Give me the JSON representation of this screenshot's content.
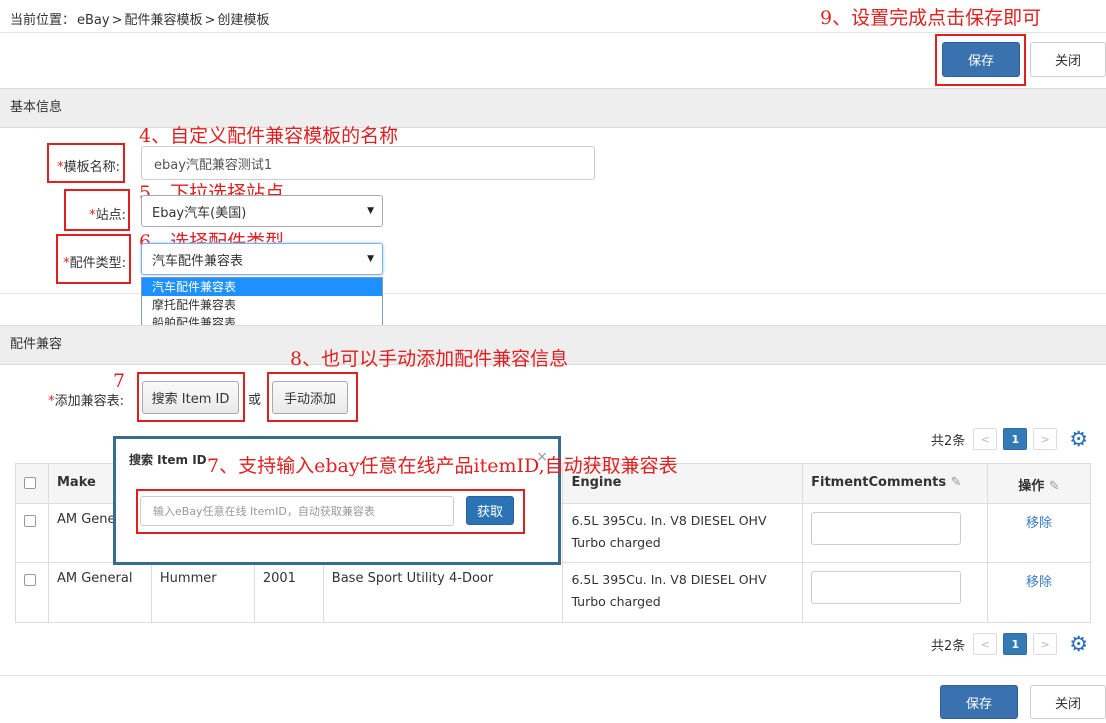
{
  "breadcrumb": {
    "prefix": "当前位置：",
    "item1": "eBay",
    "sep1": ">",
    "item2": "配件兼容模板",
    "sep2": ">",
    "item3": "创建模板"
  },
  "toolbar": {
    "save_label": "保存",
    "close_label": "关闭"
  },
  "basic_section": {
    "title": "基本信息"
  },
  "form": {
    "template_name_label": "模板名称:",
    "template_name_value": "ebay汽配兼容测试1",
    "site_label": "站点:",
    "site_value": "Ebay汽车(美国)",
    "parts_type_label": "配件类型:",
    "parts_type_value": "汽车配件兼容表",
    "parts_type_options": [
      "汽车配件兼容表",
      "摩托配件兼容表",
      "船舶配件兼容表"
    ],
    "required_mark": "*"
  },
  "compat_section": {
    "title": "配件兼容",
    "add_label": "添加兼容表:",
    "search_button": "搜索 Item ID",
    "or_text": "或",
    "manual_button": "手动添加"
  },
  "pager": {
    "total": "共2条",
    "prev": "<",
    "page": "1",
    "next": ">"
  },
  "table": {
    "headers": [
      "Make",
      "",
      "",
      "",
      "Engine",
      "FitmentComments",
      "操作"
    ],
    "rows": [
      {
        "make": "AM General",
        "model": "",
        "year": "",
        "trim": "",
        "engine": "6.5L 395Cu. In. V8 DIESEL OHV Turbo charged",
        "action": "移除"
      },
      {
        "make": "AM General",
        "model": "Hummer",
        "year": "2001",
        "trim": "Base Sport Utility 4-Door",
        "engine": "6.5L 395Cu. In. V8 DIESEL OHV Turbo charged",
        "action": "移除"
      }
    ]
  },
  "popup": {
    "title": "搜索 Item ID",
    "close": "×",
    "input_placeholder": "输入eBay任意在线 ItemID，自动获取兼容表",
    "fetch_button": "获取"
  },
  "annotations": {
    "a4": "4、自定义配件兼容模板的名称",
    "a5": "5、下拉选择站点",
    "a6": "6、选择配件类型",
    "a7_num": "7",
    "a7": "7、支持输入ebay任意在线产品itemID,自动获取兼容表",
    "a8": "8、也可以手动添加配件兼容信息",
    "a9": "9、设置完成点击保存即可"
  },
  "colors": {
    "primary": "#3a72b0",
    "annotation": "#e02020",
    "popup_border": "#3b6a8f",
    "link": "#3a7bc8"
  }
}
